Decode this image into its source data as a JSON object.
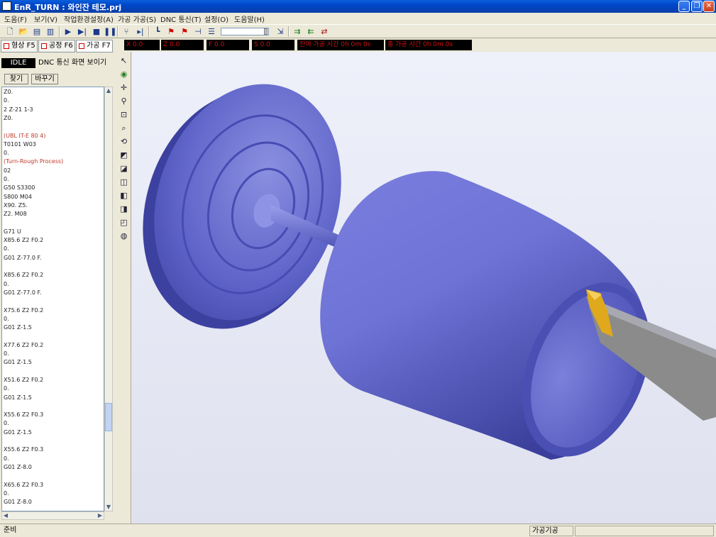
{
  "window": {
    "title": "EnR_TURN : 와인잔 테모.prj",
    "controls": [
      "_",
      "❐",
      "✕"
    ]
  },
  "menu": [
    "도움(F)",
    "보기(V)",
    "작업환경설정(A)",
    "가공 가공(S)",
    "DNC 통신(T)",
    "설정(O)",
    "도움말(H)"
  ],
  "toolbar_icons": [
    "new-icon",
    "open-icon",
    "save-icon",
    "save-all-icon",
    "play-icon",
    "step-icon",
    "stop-icon",
    "pause-icon",
    "tool-icon",
    "next-icon",
    "graph-icon",
    "flag-icon",
    "flag-icon-2",
    "bar-icon",
    "list-icon",
    "arrow-right-icon",
    "arrow-left-icon",
    "arrow-swap-icon"
  ],
  "left_tabs": [
    "형상 F5",
    "공정 F6",
    "가공 F7"
  ],
  "status_idle": "IDLE",
  "status_dnc": "DNC 통신 화면 보이기",
  "buttons": {
    "find": "찾기",
    "apply": "바꾸기"
  },
  "nc_code": [
    {
      "t": "Z0.",
      "red": false
    },
    {
      "t": "0.",
      "red": false
    },
    {
      "t": "2 Z-21 1-3",
      "red": false
    },
    {
      "t": "Z0.",
      "red": false
    },
    {
      "t": "",
      "red": false
    },
    {
      "t": "(UBL IT-E 80 4)",
      "red": true
    },
    {
      "t": "T0101 W03",
      "red": false
    },
    {
      "t": "0.",
      "red": false
    },
    {
      "t": "(Turn-Rough Process)",
      "red": true
    },
    {
      "t": "02",
      "red": false
    },
    {
      "t": "0.",
      "red": false
    },
    {
      "t": "G50 S3300",
      "red": false
    },
    {
      "t": "S800 M04",
      "red": false
    },
    {
      "t": "X90. Z5.",
      "red": false
    },
    {
      "t": "Z2. M08",
      "red": false
    },
    {
      "t": "",
      "red": false
    },
    {
      "t": "G71 U",
      "red": false
    },
    {
      "t": "X85.6 Z2 F0.2",
      "red": false
    },
    {
      "t": "0.",
      "red": false
    },
    {
      "t": "G01 Z-77.0 F.",
      "red": false
    },
    {
      "t": "",
      "red": false
    },
    {
      "t": "X85.6 Z2 F0.2",
      "red": false
    },
    {
      "t": "0.",
      "red": false
    },
    {
      "t": "G01 Z-77.0 F.",
      "red": false
    },
    {
      "t": "",
      "red": false
    },
    {
      "t": "X75.6 Z2 F0.2",
      "red": false
    },
    {
      "t": "0.",
      "red": false
    },
    {
      "t": "G01 Z-1.5",
      "red": false
    },
    {
      "t": "",
      "red": false
    },
    {
      "t": "X77.6 Z2 F0.2",
      "red": false
    },
    {
      "t": "0.",
      "red": false
    },
    {
      "t": "G01 Z-1.5",
      "red": false
    },
    {
      "t": "",
      "red": false
    },
    {
      "t": "X51.6 Z2 F0.2",
      "red": false
    },
    {
      "t": "0.",
      "red": false
    },
    {
      "t": "G01 Z-1.5",
      "red": false
    },
    {
      "t": "",
      "red": false
    },
    {
      "t": "X55.6 Z2 F0.3",
      "red": false
    },
    {
      "t": "0.",
      "red": false
    },
    {
      "t": "G01 Z-1.5",
      "red": false
    },
    {
      "t": "",
      "red": false
    },
    {
      "t": "X55.6 Z2 F0.3",
      "red": false
    },
    {
      "t": "0.",
      "red": false
    },
    {
      "t": "G01 Z-8.0",
      "red": false
    },
    {
      "t": "",
      "red": false
    },
    {
      "t": "X65.6 Z2 F0.3",
      "red": false
    },
    {
      "t": "0.",
      "red": false
    },
    {
      "t": "G01 Z-8.0",
      "red": false
    }
  ],
  "readouts": [
    "X 0.0",
    "Z 0.0",
    "F 0.0",
    "S 0.0",
    "잔여 가공 시간 0h 0m 0s",
    "총 가공 시간 0h 0m 0s"
  ],
  "status": {
    "left": "준비",
    "mode": "가공기공"
  }
}
